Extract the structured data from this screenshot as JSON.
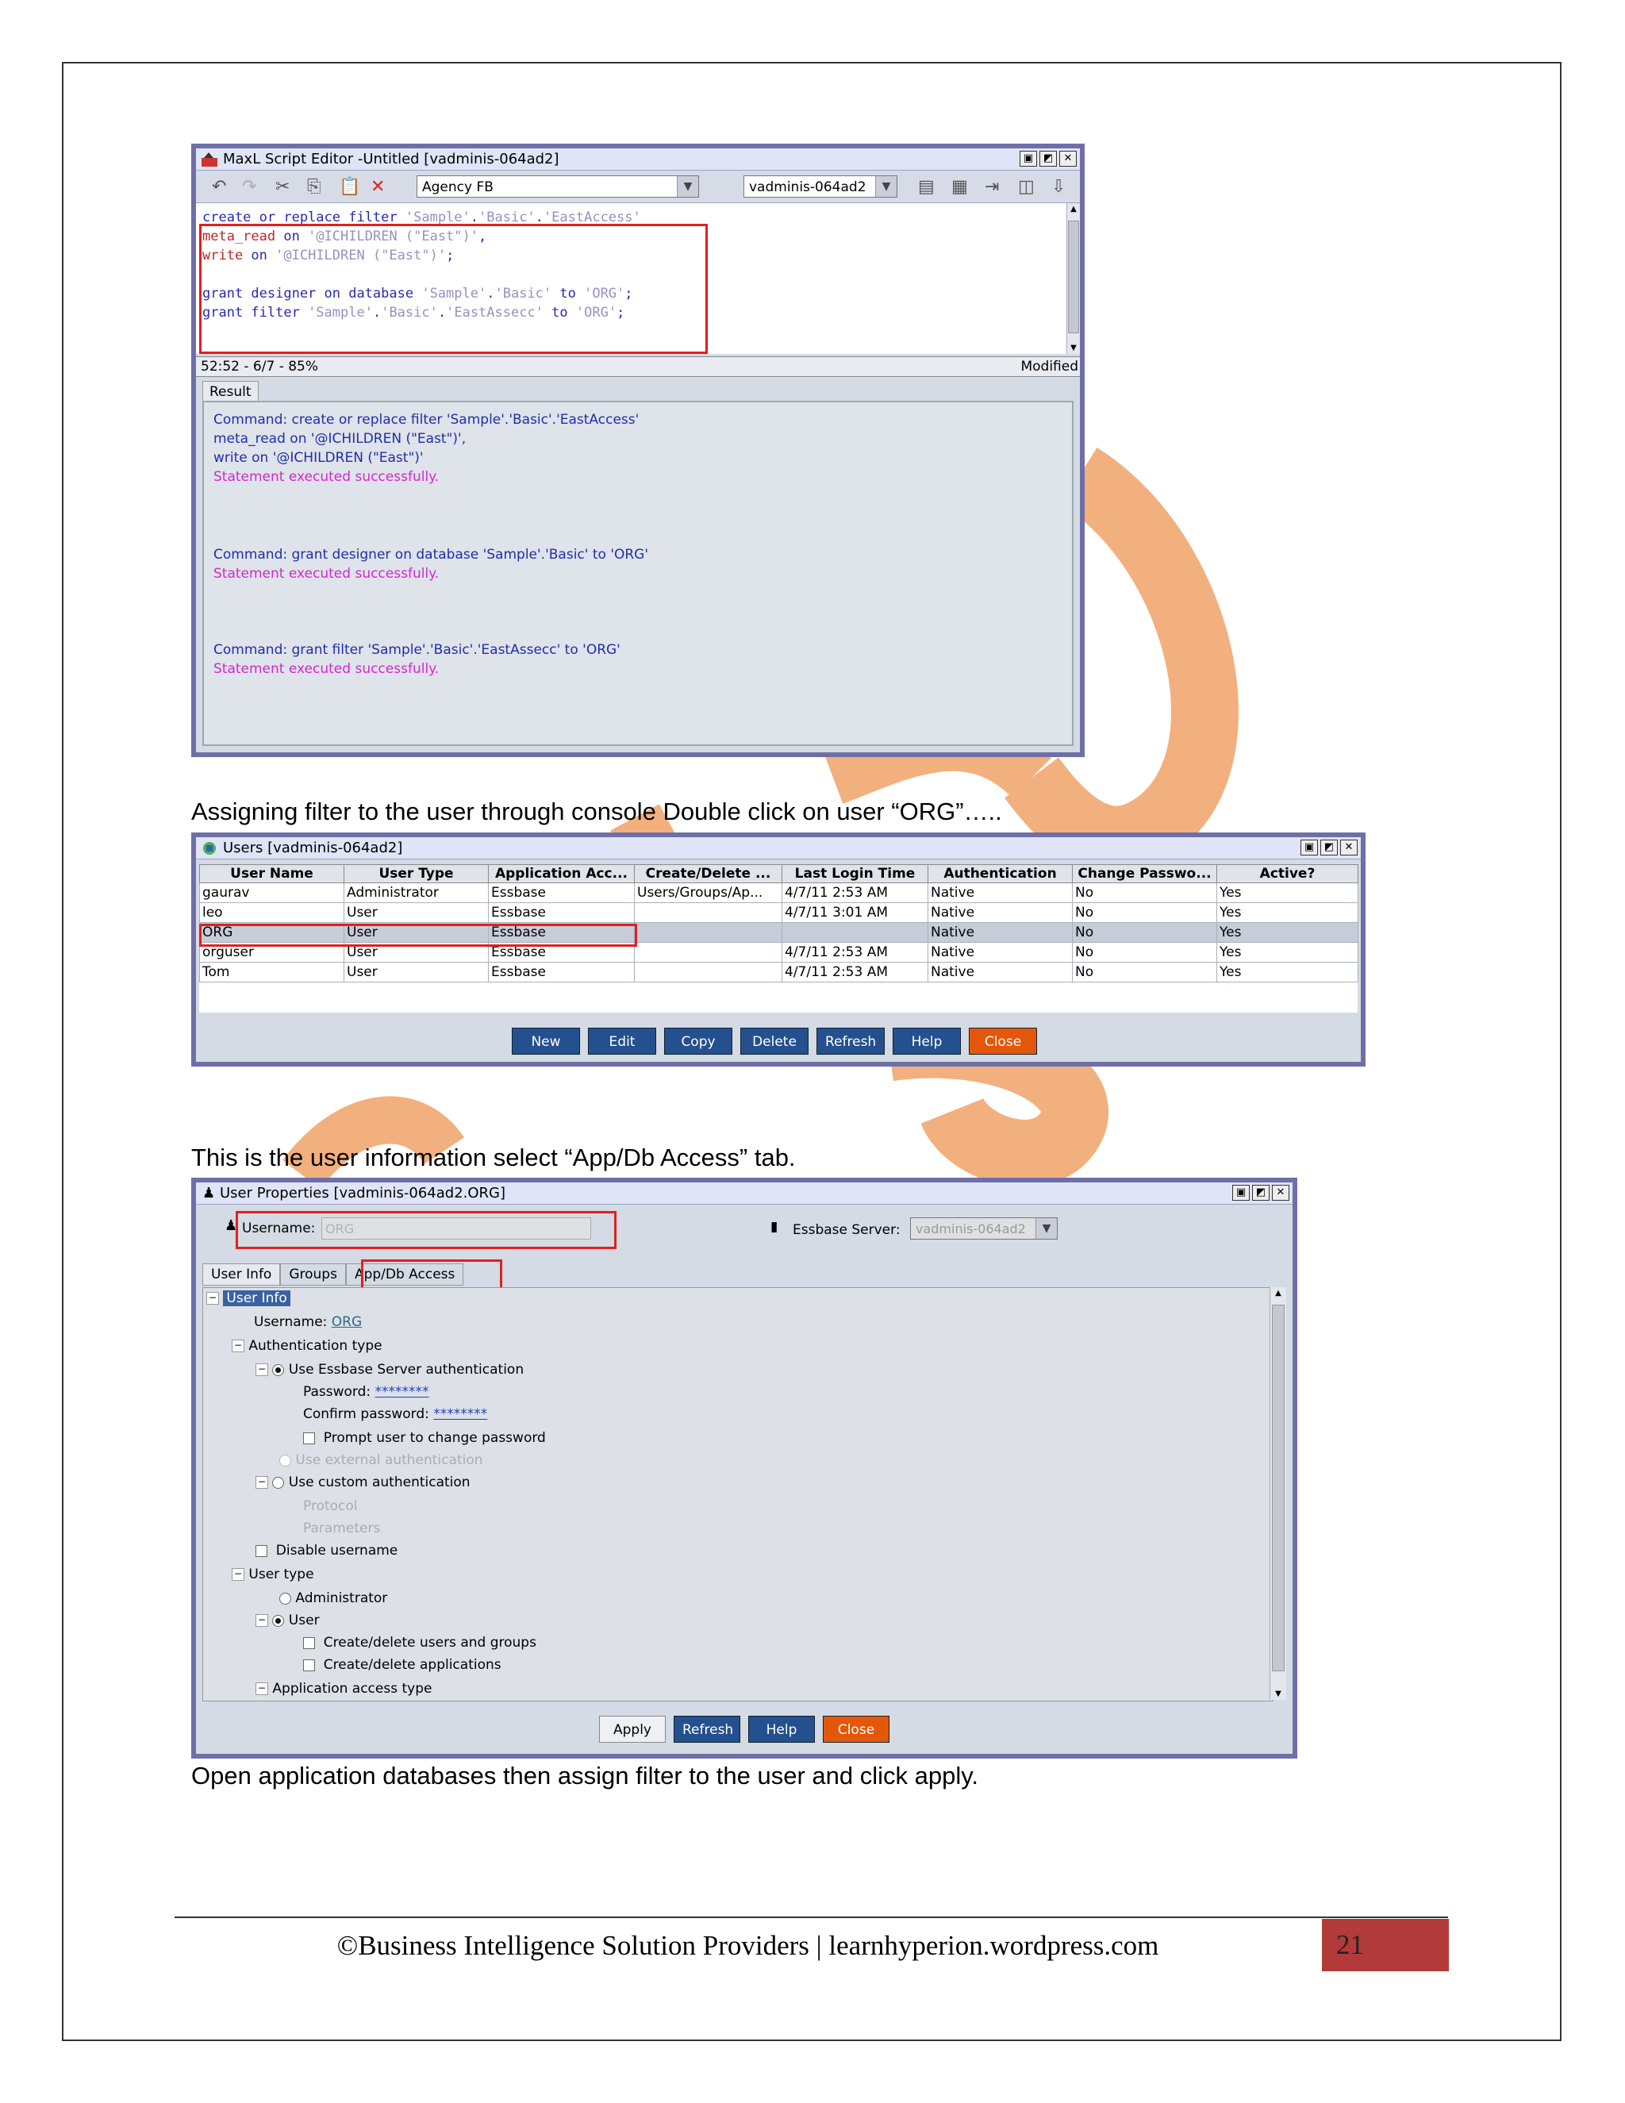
{
  "maxl": {
    "title": "MaxL Script Editor -Untitled [vadminis-064ad2]",
    "app_combo": "Agency FB",
    "server_combo": "vadminis-064ad2",
    "code": [
      [
        [
          "kw",
          "create or replace filter "
        ],
        [
          "str",
          "'Sample'"
        ],
        [
          "kw",
          "."
        ],
        [
          "str",
          "'Basic'"
        ],
        [
          "kw",
          "."
        ],
        [
          "str",
          "'EastAccess'"
        ]
      ],
      [
        [
          "kwr",
          "meta_read"
        ],
        [
          "kw",
          " on "
        ],
        [
          "str",
          "'@ICHILDREN (\"East\")'"
        ],
        [
          "kw",
          ","
        ]
      ],
      [
        [
          "kwr",
          "write"
        ],
        [
          "kw",
          " on "
        ],
        [
          "str",
          "'@ICHILDREN (\"East\")'"
        ],
        [
          "kw",
          ";"
        ]
      ],
      [],
      [
        [
          "kw",
          "grant designer on database "
        ],
        [
          "str",
          "'Sample'"
        ],
        [
          "kw",
          "."
        ],
        [
          "str",
          "'Basic'"
        ],
        [
          "kw",
          " to "
        ],
        [
          "str",
          "'ORG'"
        ],
        [
          "kw",
          ";"
        ]
      ],
      [
        [
          "kw",
          "grant filter "
        ],
        [
          "str",
          "'Sample'"
        ],
        [
          "kw",
          "."
        ],
        [
          "str",
          "'Basic'"
        ],
        [
          "kw",
          "."
        ],
        [
          "str",
          "'EastAssecc'"
        ],
        [
          "kw",
          " to "
        ],
        [
          "str",
          "'ORG'"
        ],
        [
          "kw",
          ";"
        ]
      ]
    ],
    "status_left": "52:52 - 6/7 - 85%",
    "status_right": "Modified",
    "result_tab": "Result",
    "result_lines": [
      {
        "t": "Command: create or replace filter 'Sample'.'Basic'.'EastAccess'",
        "ok": false
      },
      {
        "t": "meta_read on '@ICHILDREN (\"East\")',",
        "ok": false
      },
      {
        "t": "write on '@ICHILDREN (\"East\")'",
        "ok": false
      },
      {
        "t": "Statement executed successfully.",
        "ok": true
      },
      {
        "t": "Command: grant designer on database 'Sample'.'Basic' to 'ORG'",
        "ok": false
      },
      {
        "t": "Statement executed successfully.",
        "ok": true
      },
      {
        "t": "Command: grant filter 'Sample'.'Basic'.'EastAssecc' to 'ORG'",
        "ok": false
      },
      {
        "t": "Statement executed successfully.",
        "ok": true
      }
    ]
  },
  "text1": "Assigning filter to the user through console Double click on user “ORG”…..",
  "users": {
    "title": "Users [vadminis-064ad2]",
    "columns": [
      "User Name",
      "User Type",
      "Application Acc...",
      "Create/Delete ...",
      "Last Login Time",
      "Authentication",
      "Change Passwo...",
      "Active?"
    ],
    "rows": [
      [
        "gaurav",
        "Administrator",
        "Essbase",
        "Users/Groups/Ap...",
        "4/7/11 2:53 AM",
        "Native",
        "No",
        "Yes"
      ],
      [
        "leo",
        "User",
        "Essbase",
        "",
        "4/7/11 3:01 AM",
        "Native",
        "No",
        "Yes"
      ],
      [
        "ORG",
        "User",
        "Essbase",
        "",
        "",
        "Native",
        "No",
        "Yes"
      ],
      [
        "orguser",
        "User",
        "Essbase",
        "",
        "4/7/11 2:53 AM",
        "Native",
        "No",
        "Yes"
      ],
      [
        "Tom",
        "User",
        "Essbase",
        "",
        "4/7/11 2:53 AM",
        "Native",
        "No",
        "Yes"
      ]
    ],
    "buttons": [
      "New",
      "Edit",
      "Copy",
      "Delete",
      "Refresh",
      "Help",
      "Close"
    ]
  },
  "text2": "This is the user information select “App/Db Access” tab.",
  "props": {
    "title": "User Properties [vadminis-064ad2.ORG]",
    "username_label": "Username:",
    "username_value": "ORG",
    "server_label": "Essbase Server:",
    "server_value": "vadminis-064ad2",
    "tabs": [
      "User Info",
      "Groups",
      "App/Db Access"
    ],
    "tree": {
      "root": "User Info",
      "username_label": "Username:",
      "username_value": "ORG",
      "auth_type": "Authentication type",
      "use_essbase": "Use Essbase Server authentication",
      "password_label": "Password:",
      "password_value": "********",
      "confirm_label": "Confirm password:",
      "confirm_value": "********",
      "prompt_change": "Prompt user to change password",
      "use_external": "Use external authentication",
      "use_custom": "Use custom authentication",
      "protocol": "Protocol",
      "parameters": "Parameters",
      "disable_username": "Disable username",
      "user_type": "User type",
      "administrator": "Administrator",
      "user": "User",
      "create_users": "Create/delete users and groups",
      "create_apps": "Create/delete applications",
      "app_access": "Application access type"
    },
    "buttons": [
      "Apply",
      "Refresh",
      "Help",
      "Close"
    ]
  },
  "text3": "Open application databases then assign filter to the user and click apply.",
  "footer": {
    "text": "©Business Intelligence Solution Providers | learnhyperion.wordpress.com",
    "page": "21"
  },
  "colors": {
    "watermark": "#f2b07e",
    "accent_red": "#e02020",
    "window_border": "#6f6fa8",
    "close_orange": "#e4570a"
  }
}
